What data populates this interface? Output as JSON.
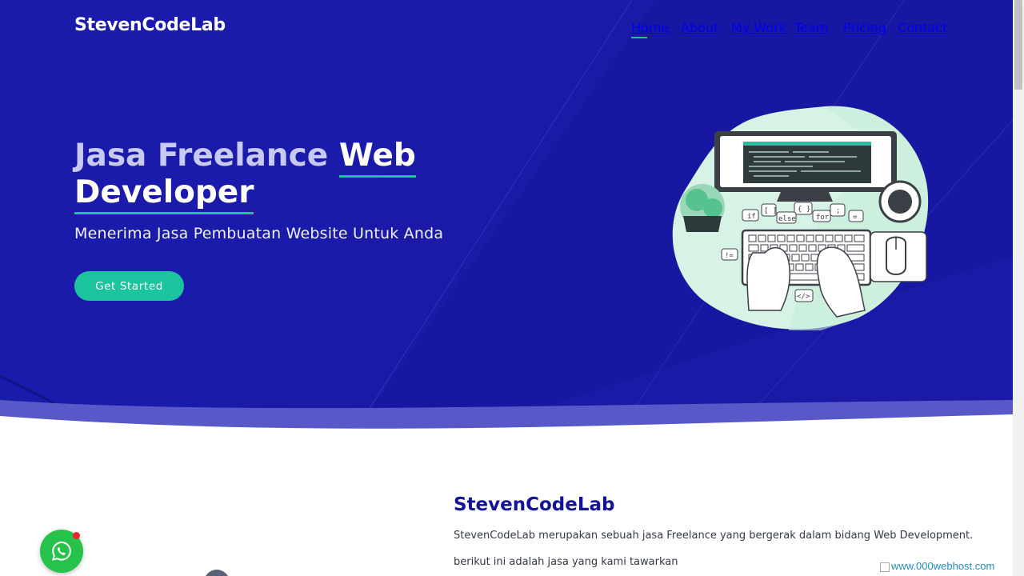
{
  "brand": "StevenCodeLab",
  "nav": {
    "items": [
      {
        "label": "Home",
        "active": true
      },
      {
        "label": "About",
        "active": false
      },
      {
        "label": "My Work",
        "active": false
      },
      {
        "label": "Team",
        "active": false
      },
      {
        "label": "Pricing",
        "active": false
      },
      {
        "label": "Contact",
        "active": false
      }
    ]
  },
  "hero": {
    "headline_part1": "Jasa Freelance ",
    "headline_part2": "Web",
    "headline_part3": "Developer",
    "subtitle": "Menerima Jasa Pembuatan Website Untuk Anda",
    "cta_label": "Get Started",
    "illustration_labels": [
      "[ ]",
      "{ }",
      "if",
      "else",
      "for",
      ";",
      "=",
      "!=",
      "</>"
    ]
  },
  "about": {
    "title": "StevenCodeLab",
    "paragraph1": "StevenCodeLab merupakan sebuah jasa Freelance yang bergerak dalam bidang Web Development.",
    "paragraph2": "berikut ini adalah jasa yang kami tawarkan"
  },
  "host_badge": "www.000webhost.com",
  "colors": {
    "hero_bg": "#1a1aa6",
    "accent": "#1bc49d",
    "title": "#12129a",
    "whatsapp": "#27c24a"
  },
  "icons": {
    "whatsapp": "whatsapp-icon",
    "notification": "notification-dot-icon"
  }
}
